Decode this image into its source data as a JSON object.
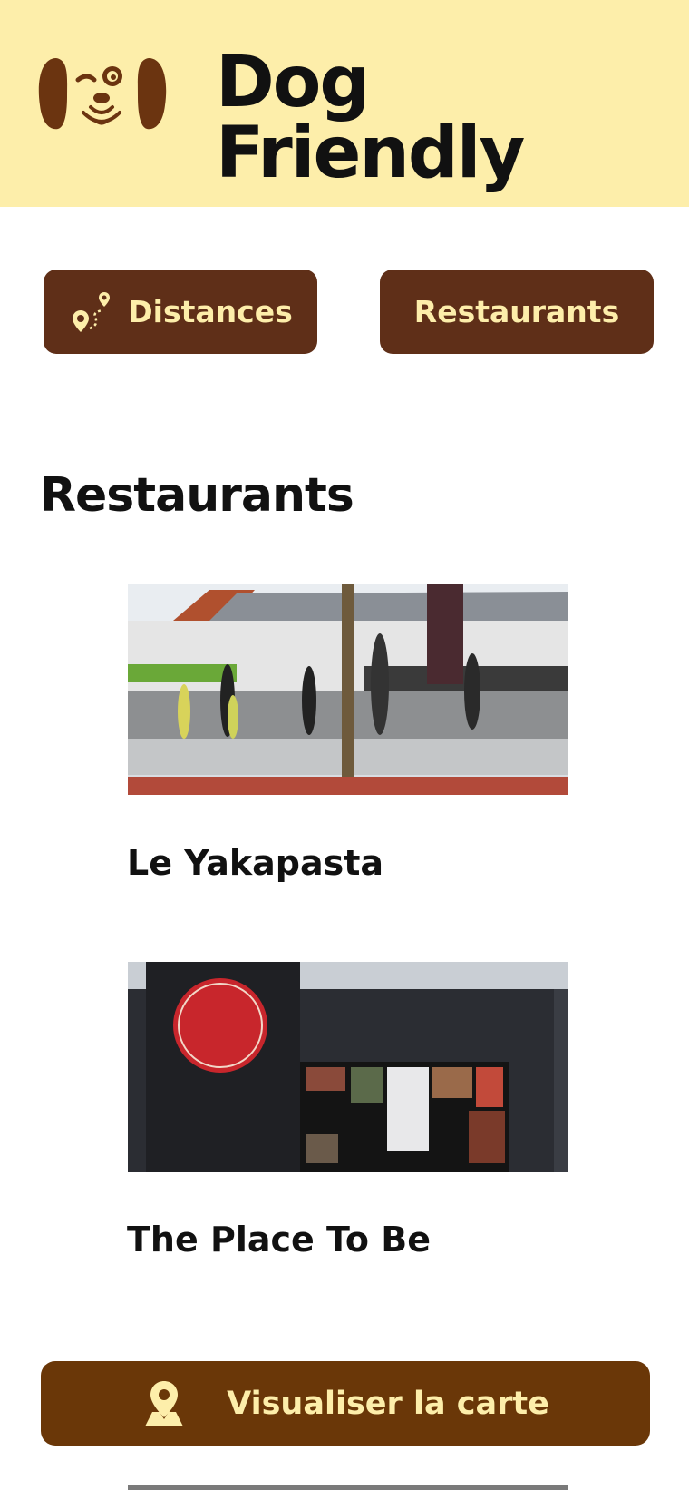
{
  "header": {
    "title": "Dog Friendly",
    "logo_icon": "dog-face-icon",
    "background": "#fdeeaa"
  },
  "nav": {
    "distances_label": "Distances",
    "distances_icon": "route-pin-icon",
    "restaurants_label": "Restaurants"
  },
  "section": {
    "title": "Restaurants"
  },
  "restaurants": [
    {
      "name": "Le Yakapasta",
      "photo_icon": "restaurant-photo"
    },
    {
      "name": "The Place To Be",
      "photo_icon": "restaurant-photo"
    }
  ],
  "map_button": {
    "label": "Visualiser la carte",
    "icon": "map-pin-icon"
  },
  "colors": {
    "brown_button": "#5f2f18",
    "map_button": "#6a3708",
    "button_text": "#fdeeaa"
  }
}
